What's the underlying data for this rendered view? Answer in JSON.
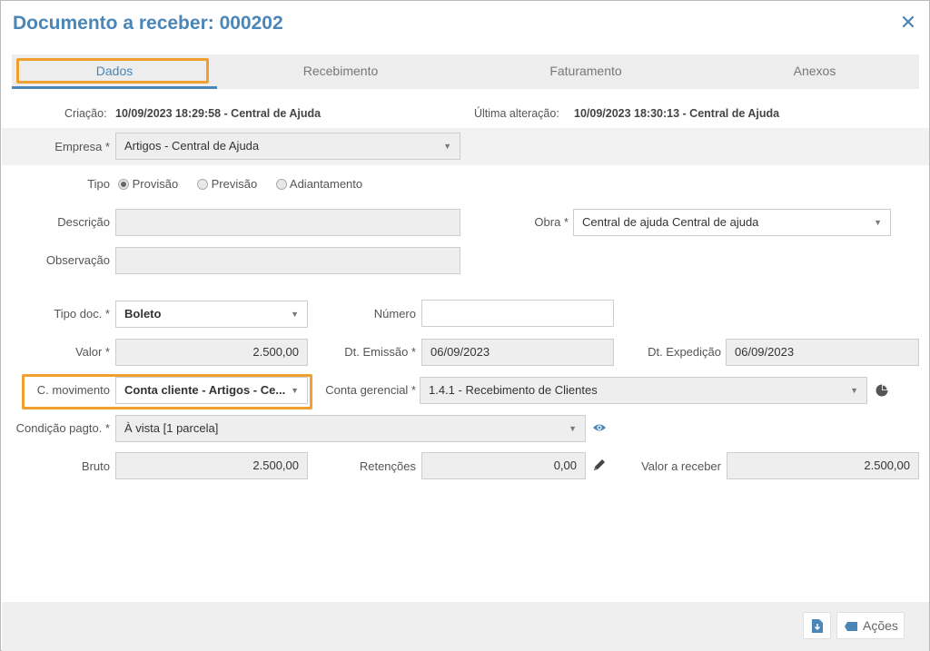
{
  "dialog": {
    "title": "Documento a receber: 000202",
    "close_glyph": "✕"
  },
  "tabs": [
    {
      "label": "Dados",
      "active": true
    },
    {
      "label": "Recebimento",
      "active": false
    },
    {
      "label": "Faturamento",
      "active": false
    },
    {
      "label": "Anexos",
      "active": false
    }
  ],
  "meta": {
    "created_label": "Criação:",
    "created_value": "10/09/2023 18:29:58 - Central de Ajuda",
    "updated_label": "Última alteração:",
    "updated_value": "10/09/2023 18:30:13 - Central de Ajuda"
  },
  "form": {
    "empresa": {
      "label": "Empresa *",
      "value": "Artigos - Central de Ajuda"
    },
    "tipo": {
      "label": "Tipo",
      "options": [
        {
          "label": "Provisão",
          "selected": true
        },
        {
          "label": "Previsão",
          "selected": false
        },
        {
          "label": "Adiantamento",
          "selected": false
        }
      ]
    },
    "descricao": {
      "label": "Descrição",
      "value": ""
    },
    "obra": {
      "label": "Obra *",
      "value": "Central de ajuda Central de ajuda"
    },
    "observacao": {
      "label": "Observação",
      "value": ""
    },
    "tipo_doc": {
      "label": "Tipo doc. *",
      "value": "Boleto"
    },
    "numero": {
      "label": "Número",
      "value": ""
    },
    "valor": {
      "label": "Valor *",
      "value": "2.500,00"
    },
    "dt_emissao": {
      "label": "Dt. Emissão *",
      "value": "06/09/2023"
    },
    "dt_expedicao": {
      "label": "Dt. Expedição",
      "value": "06/09/2023"
    },
    "c_movimento": {
      "label": "C. movimento",
      "value": "Conta cliente - Artigos - Ce..."
    },
    "conta_gerencial": {
      "label": "Conta gerencial *",
      "value": "1.4.1 - Recebimento de Clientes"
    },
    "condicao_pagto": {
      "label": "Condição pagto. *",
      "value": "À vista [1 parcela]"
    },
    "bruto": {
      "label": "Bruto",
      "value": "2.500,00"
    },
    "retencoes": {
      "label": "Retenções",
      "value": "0,00"
    },
    "valor_receber": {
      "label": "Valor a receber",
      "value": "2.500,00"
    }
  },
  "icons": {
    "dropdown": "▼",
    "pie": "pie-chart-icon",
    "eye": "eye-icon",
    "pencil": "pencil-icon",
    "document": "document-icon",
    "actions": "actions-icon"
  },
  "footer": {
    "actions_label": "Ações"
  },
  "colors": {
    "accent": "#4a86b8",
    "highlight": "#f0a030"
  }
}
